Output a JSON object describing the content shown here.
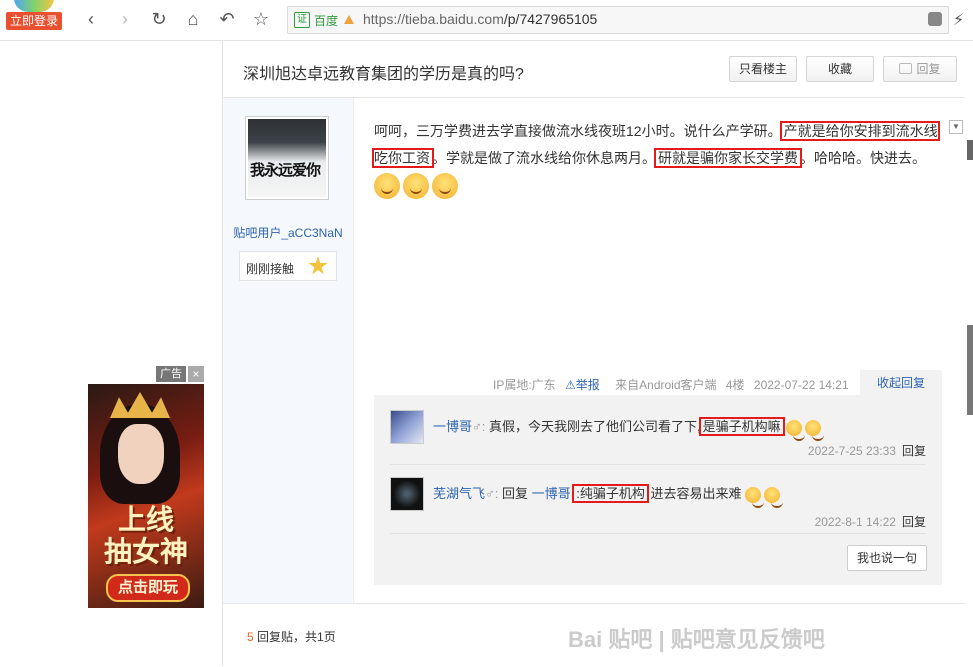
{
  "browser": {
    "login_label": "立即登录",
    "cert_label": "证",
    "cert_name": "百度",
    "url_host": "https://tieba.baidu.com",
    "url_path": "/p/7427965105"
  },
  "header": {
    "title": "深圳旭达卓远教育集团的学历是真的吗?",
    "btn_author_only": "只看楼主",
    "btn_favorite": "收藏",
    "btn_reply": "回复"
  },
  "post": {
    "author_name": "贴吧用户_aCC3NaN",
    "avatar_text": "我永远爱你",
    "level_name": "刚刚接触",
    "content_parts": {
      "p1": "呵呵，三万学费进去学直接做流水线夜班12小时。说什么产学研。",
      "h1": "产就是给你安排到流水线吃你工资",
      "p2": "。学就是做了流水线给你休息两月。",
      "h2": "研就是骗你家长交学费",
      "p3": "。哈哈哈。快进去。"
    },
    "meta": {
      "ip": "IP属地:广东",
      "report": "举报",
      "client": "来自Android客户端",
      "floor": "4楼",
      "time": "2022-07-22 14:21"
    },
    "collapse_label": "收起回复"
  },
  "replies": [
    {
      "name": "一博哥",
      "text": "真假，今天我刚去了他们公司看了下,",
      "highlight": "是骗子机构嘛",
      "time": "2022-7-25 23:33",
      "reply_label": "回复"
    },
    {
      "name": "芜湖气飞",
      "prefix": "回复",
      "target": "一博哥",
      "highlight": ":纯骗子机构",
      "text": "进去容易出来难",
      "time": "2022-8-1 14:22",
      "reply_label": "回复"
    }
  ],
  "say_button": "我也说一句",
  "footer": {
    "count": "5",
    "count_text": "回复贴，共1页",
    "watermark": "Bai 贴吧 | 贴吧意见反馈吧"
  },
  "ad": {
    "tag": "广告",
    "close": "×",
    "title_line1": "上线",
    "title_line2": "抽女神",
    "cta": "点击即玩"
  },
  "colors": {
    "link": "#2d64b3",
    "highlight_border": "#e41b1b",
    "login_bg": "#e8502f"
  }
}
